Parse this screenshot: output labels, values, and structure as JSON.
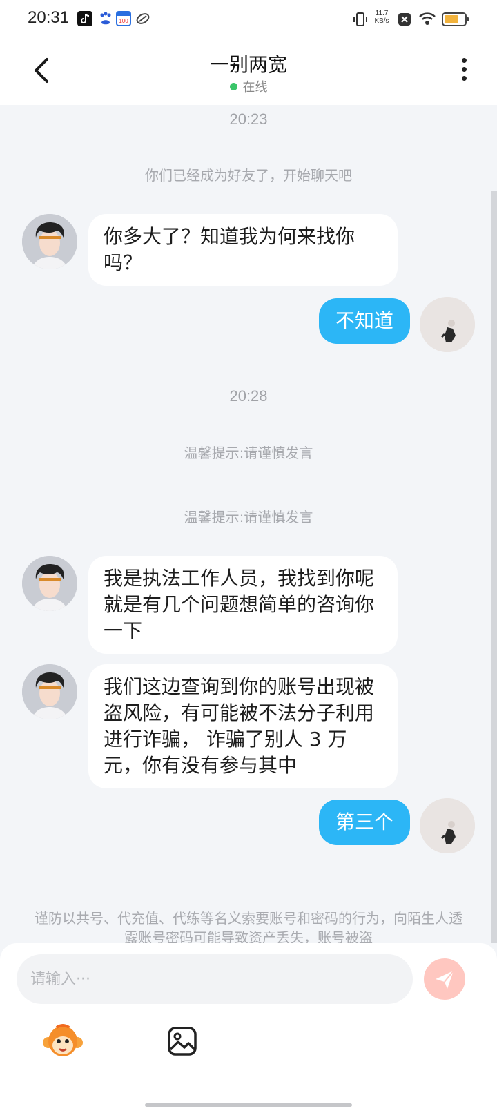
{
  "status_bar": {
    "time": "20:31",
    "net_speed_value": "11.7",
    "net_speed_unit": "KB/s",
    "app_icons": [
      "tiktok-icon",
      "baidu-icon",
      "calendar-icon",
      "app-swirl-icon"
    ]
  },
  "header": {
    "title": "一别两宽",
    "status": "在线"
  },
  "messages": {
    "time1": "20:23",
    "friend_notice": "你们已经成为好友了，开始聊天吧",
    "msg1": "你多大了？知道我为何来找你吗？",
    "reply1": "不知道",
    "time2": "20:28",
    "tip1": "温馨提示:请谨慎发言",
    "tip2": "温馨提示:请谨慎发言",
    "msg2": "我是执法工作人员，我找到你呢就是有几个问题想简单的咨询你一下",
    "msg3": "我们这边查询到你的账号出现被盗风险，有可能被不法分子利用进行诈骗， 诈骗了别人 3 万元，你有没有参与其中",
    "reply2": "第三个",
    "safety_notice": "谨防以共号、代充值、代练等名义索要账号和密码的行为，向陌生人透露账号密码可能导致资产丢失，账号被盗"
  },
  "input": {
    "placeholder": "请输入···"
  },
  "colors": {
    "outgoing_bubble": "#2cb6f6",
    "incoming_bubble": "#ffffff",
    "online_dot": "#3ac569",
    "send_button": "#ffc7c0"
  }
}
